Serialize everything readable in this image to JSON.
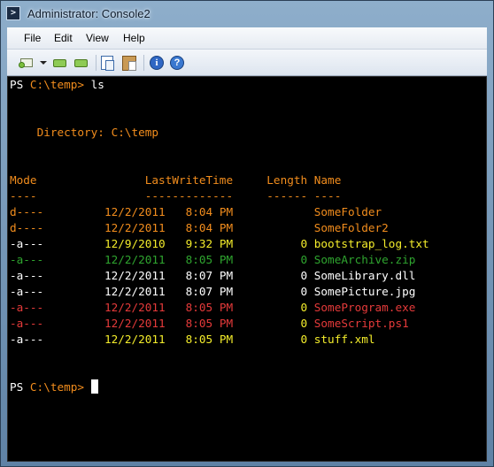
{
  "window": {
    "title": "Administrator: Console2",
    "icon": "console-app-icon"
  },
  "menu": {
    "items": [
      "File",
      "Edit",
      "View",
      "Help"
    ]
  },
  "toolbar": {
    "buttons": [
      {
        "name": "new-tab-icon"
      },
      {
        "name": "chevron-down-icon"
      },
      {
        "name": "previous-tab-icon"
      },
      {
        "name": "next-tab-icon"
      },
      {
        "name": "copy-icon"
      },
      {
        "name": "paste-icon"
      },
      {
        "name": "info-icon"
      },
      {
        "name": "help-icon"
      }
    ]
  },
  "colors": {
    "console_bg": "#000000",
    "text_white": "#ffffff",
    "text_orange": "#f28d1d",
    "text_yellow": "#f4ed2b",
    "text_green": "#2fa52f",
    "text_red": "#e53a3a"
  },
  "console": {
    "prompt_ps": "PS",
    "prompt_path": "C:\\temp>",
    "command": "ls",
    "directory_label": "Directory: C:\\temp",
    "headers": {
      "mode": "Mode",
      "lastwritetime": "LastWriteTime",
      "length": "Length",
      "name": "Name"
    },
    "underlines": {
      "mode": "----",
      "lastwritetime": "-------------",
      "length": "------",
      "name": "----"
    },
    "rows": [
      {
        "mode": "d----",
        "date": "12/2/2011",
        "time": "8:04 PM",
        "length": "",
        "name": "SomeFolder",
        "color": "orange"
      },
      {
        "mode": "d----",
        "date": "12/2/2011",
        "time": "8:04 PM",
        "length": "",
        "name": "SomeFolder2",
        "color": "orange"
      },
      {
        "mode": "-a---",
        "date": "12/9/2010",
        "time": "9:32 PM",
        "length": "0",
        "name": "bootstrap_log.txt",
        "color": "yellow"
      },
      {
        "mode": "-a---",
        "date": "12/2/2011",
        "time": "8:05 PM",
        "length": "0",
        "name": "SomeArchive.zip",
        "color": "green"
      },
      {
        "mode": "-a---",
        "date": "12/2/2011",
        "time": "8:07 PM",
        "length": "0",
        "name": "SomeLibrary.dll",
        "color": "white"
      },
      {
        "mode": "-a---",
        "date": "12/2/2011",
        "time": "8:07 PM",
        "length": "0",
        "name": "SomePicture.jpg",
        "color": "white"
      },
      {
        "mode": "-a---",
        "date": "12/2/2011",
        "time": "8:05 PM",
        "length": "0",
        "name": "SomeProgram.exe",
        "color": "red"
      },
      {
        "mode": "-a---",
        "date": "12/2/2011",
        "time": "8:05 PM",
        "length": "0",
        "name": "SomeScript.ps1",
        "color": "red"
      },
      {
        "mode": "-a---",
        "date": "12/2/2011",
        "time": "8:05 PM",
        "length": "0",
        "name": "stuff.xml",
        "color": "yellow"
      }
    ]
  }
}
